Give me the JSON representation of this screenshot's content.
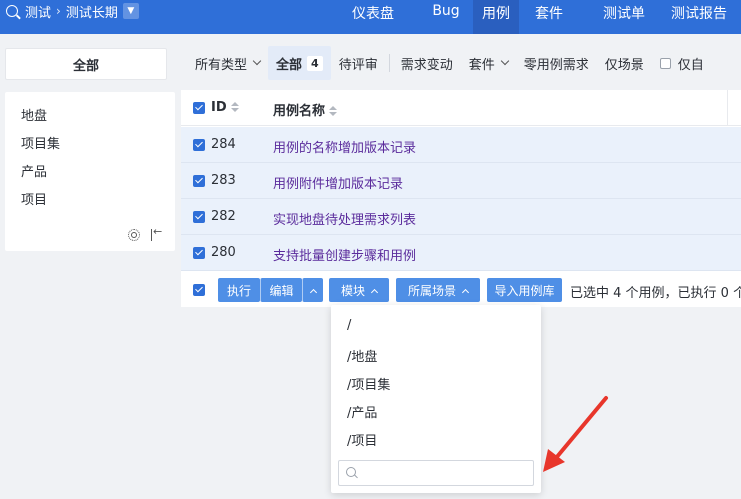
{
  "topbar": {
    "breadcrumb": [
      "测试",
      "测试长期"
    ],
    "nav": [
      "仪表盘",
      "Bug",
      "用例",
      "套件",
      "测试单",
      "测试报告"
    ],
    "active_nav": "用例"
  },
  "subbar": {
    "all_tab": "全部",
    "filters": [
      {
        "label": "所有类型",
        "has_dropdown": true
      },
      {
        "label": "全部",
        "badge": "4",
        "active": true
      },
      {
        "label": "待评审"
      },
      {
        "label": "需求变动"
      },
      {
        "label": "套件",
        "has_dropdown": true
      },
      {
        "label": "零用例需求"
      },
      {
        "label": "仅场景"
      },
      {
        "label": "仅自"
      }
    ]
  },
  "sidebar": {
    "items": [
      "地盘",
      "项目集",
      "产品",
      "项目"
    ]
  },
  "table": {
    "headers": {
      "id": "ID",
      "title": "用例名称"
    },
    "rows": [
      {
        "id": "284",
        "title": "用例的名称增加版本记录",
        "checked": true
      },
      {
        "id": "283",
        "title": "用例附件增加版本记录",
        "checked": true
      },
      {
        "id": "282",
        "title": "实现地盘待处理需求列表",
        "checked": true
      },
      {
        "id": "280",
        "title": "支持批量创建步骤和用例",
        "checked": true
      }
    ]
  },
  "actions": {
    "execute": "执行",
    "edit": "编辑",
    "module": "模块",
    "scene": "所属场景",
    "import": "导入用例库",
    "selection_info": "已选中 4 个用例，已执行 0 个"
  },
  "module_dropdown": {
    "options": [
      "/",
      "/地盘",
      "/项目集",
      "/产品",
      "/项目"
    ],
    "search_value": ""
  },
  "colors": {
    "primary": "#2f6fd8",
    "button": "#4f8fe6",
    "row_selected": "#eaf1fb",
    "link": "#5b2c9c",
    "annotation_arrow": "#e8362b"
  }
}
